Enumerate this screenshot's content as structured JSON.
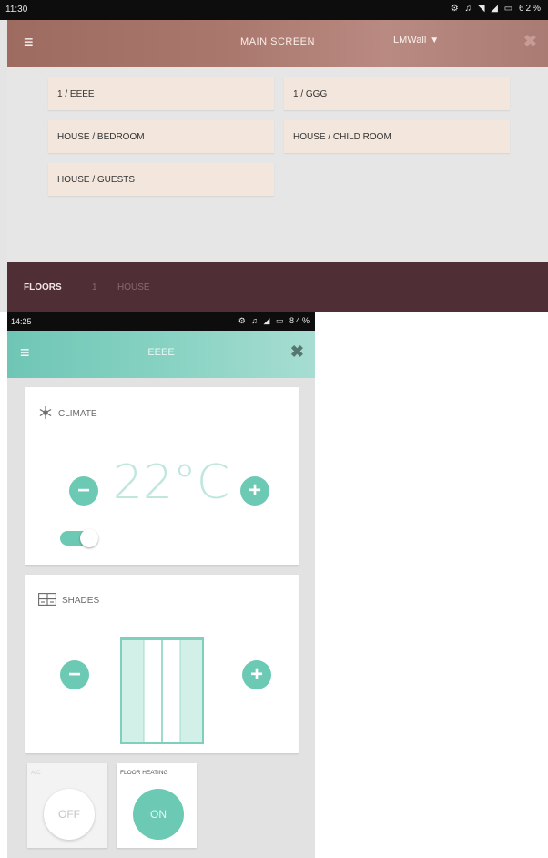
{
  "screen1": {
    "status_time": "11:30",
    "status_icons": "⚙ ♫ ◥ ◢ ▭ 62%",
    "header": {
      "title": "MAIN SCREEN",
      "dropdown_value": "LMWall",
      "menu_glyph": "≡",
      "close_glyph": "✖"
    },
    "rooms": [
      "1 / EEEE",
      "1 / GGG",
      "HOUSE / BEDROOM",
      "HOUSE / CHILD ROOM",
      "HOUSE / GUESTS"
    ],
    "bottom_tabs": [
      "FLOORS",
      "1",
      "HOUSE"
    ],
    "colors": {
      "header": "#a9776c",
      "tile": "#f3e6dd",
      "bottom_bar": "#4f2e35"
    }
  },
  "screen2": {
    "status_time": "14:25",
    "status_icons": "⚙ ♫ ◢ ▭ 84%",
    "header": {
      "title": "EEEE",
      "menu_glyph": "≡",
      "close_glyph": "✖"
    },
    "climate": {
      "label": "CLIMATE",
      "icon": "snowflake-icon",
      "temperature": "22°C",
      "minus": "−",
      "plus": "+",
      "toggle_on": true
    },
    "shades": {
      "label": "SHADES",
      "icon": "window-icon",
      "minus": "−",
      "plus": "+"
    },
    "ac_tile": {
      "label": "A/C",
      "state": "OFF"
    },
    "floor_heating_tile": {
      "label": "FLOOR HEATING",
      "state": "ON"
    },
    "colors": {
      "header": "#86d2c2",
      "accent": "#6cc9b3"
    }
  }
}
